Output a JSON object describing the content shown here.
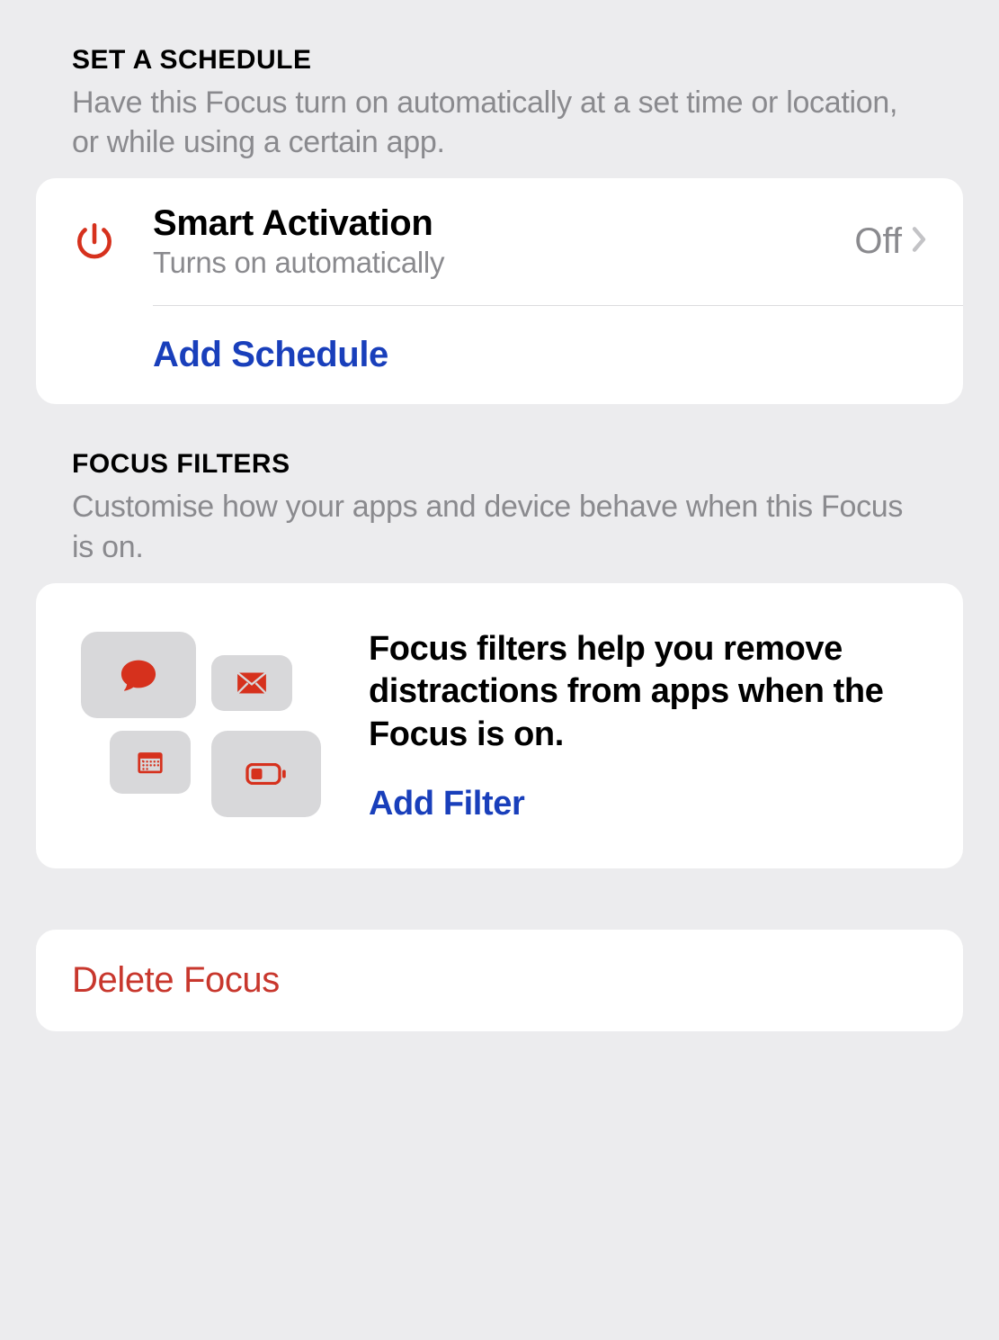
{
  "schedule": {
    "header_title": "SET A SCHEDULE",
    "header_desc": "Have this Focus turn on automatically at a set time or location, or while using a certain app.",
    "smart_activation": {
      "title": "Smart Activation",
      "subtitle": "Turns on automatically",
      "value": "Off"
    },
    "add_label": "Add Schedule"
  },
  "filters": {
    "header_title": "FOCUS FILTERS",
    "header_desc": "Customise how your apps and device behave when this Focus is on.",
    "description": "Focus filters help you remove distractions from apps when the Focus is on.",
    "add_label": "Add Filter",
    "tiles": [
      {
        "icon": "chat-bubble-icon"
      },
      {
        "icon": "mail-icon"
      },
      {
        "icon": "calendar-icon"
      },
      {
        "icon": "battery-icon"
      }
    ]
  },
  "delete": {
    "label": "Delete Focus"
  },
  "colors": {
    "accent_orange": "#D6311D",
    "link_blue": "#193fbb",
    "destructive_red": "#C8372D"
  }
}
